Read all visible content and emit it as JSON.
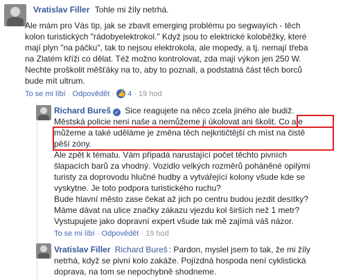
{
  "comments": [
    {
      "author": "Vratislav Filler",
      "first_line_text": "Tohle mi žíly netrhá.",
      "lines": [
        "Ale mám pro Vás tip, jak se zbavit emerging problému po segwayích - těch",
        "kolon turistických \"rádobyelektrokol.\" Když jsou to elektrické koloběžky, které",
        "mají plyn \"na páčku\", tak to nejsou elektrokola, ale mopedy, a tj. nemají třeba",
        "na Zlatém kříži co dělat. Též možno kontrolovat, zda mají výkon jen 250 W.",
        "Nechte proškolit měšťáky na to, aby to poznali, a podstatná část těch borců",
        "bude mít ultrum."
      ],
      "like_label": "To se mi líbí",
      "reply_label": "Odpovědět",
      "reaction_count": "4",
      "time": "19 hod"
    },
    {
      "author": "Richard Bureš",
      "lines": [
        "Sice reagujete na něco zcela jiného ale budiž.",
        "Městská policie není naše a nemůžeme ji úkolovat ani školit.",
        "můžeme a také uděláme je změna těch nejkritičtější ch míst na čistě",
        "pěší zóny.",
        "Ale zpět k tématu. Vám připadá narustající počet těchto pivních",
        "šlapacích barů za vhodný. Vozidlo velkých rozměrů poháněné opilými",
        "turisty za doprovodu hlučné hudby a vytvářející kolony všude kde se",
        "vyskytne. Je toto podpora turistického ruchu?",
        "Bude hlavní město zase čekat až jich po centru budou jezdit desítky?",
        "Máme dávat na ulice značky zákazu vjezdu kol širších než 1 metr?",
        "Vystupujete jako dopravní expert všude tak mě zajímá váš názor."
      ],
      "highlight_start": "Co ale",
      "like_label": "To se mi líbí",
      "reply_label": "Odpovědět",
      "time": "19 hod"
    },
    {
      "author": "Vratislav Filler",
      "mention": "Richard Bureš",
      "lines": [
        ": Pardon, myslel jsem to tak, že mi žíly",
        "netrhá, když se pivní kolo zakáže. Pojízdná hospoda není cyklistická",
        "doprava, na tom se nepochybně shodneme."
      ]
    }
  ],
  "colors": {
    "name": "#365899",
    "meta": "#90949c",
    "highlight_box": "#e02020"
  }
}
